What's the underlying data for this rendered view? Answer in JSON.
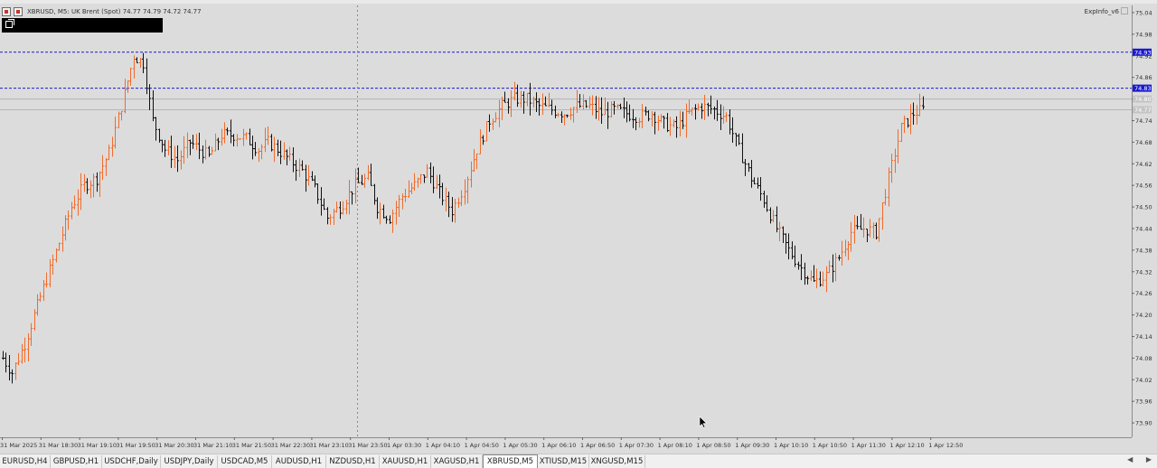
{
  "header": {
    "symbol_line": "XBRUSD, M5:  UK Brent (Spot)  74.77 74.79 74.72 74.77",
    "indicator": "ExpInfo_v6"
  },
  "colors": {
    "background": "#dcdcdc",
    "bull": "#f26b2a",
    "bear": "#111111",
    "hline": "#1a1ad0",
    "price_tag": "#1a1ad0",
    "gray_tag": "#c4c4c4"
  },
  "chart_data": {
    "type": "ohlc",
    "title": "XBRUSD, M5",
    "ylim": [
      73.86,
      75.06
    ],
    "price_ticks": [
      "75.04",
      "74.98",
      "74.92",
      "74.86",
      "74.80",
      "74.74",
      "74.68",
      "74.62",
      "74.56",
      "74.50",
      "74.44",
      "74.38",
      "74.32",
      "74.26",
      "74.20",
      "74.14",
      "74.08",
      "74.02",
      "73.96",
      "73.90"
    ],
    "price_tags": [
      {
        "label": "74.93",
        "value": 74.93,
        "style": "blue"
      },
      {
        "label": "74.83",
        "value": 74.83,
        "style": "blue"
      },
      {
        "label": "74.80",
        "value": 74.8,
        "style": "gray"
      },
      {
        "label": "74.77",
        "value": 74.77,
        "style": "gray"
      }
    ],
    "hlines": [
      74.93,
      74.83
    ],
    "gray_lines": [
      74.8,
      74.77
    ],
    "time_labels": [
      "31 Mar 2025",
      "31 Mar 18:30",
      "31 Mar 19:10",
      "31 Mar 19:50",
      "31 Mar 20:30",
      "31 Mar 21:10",
      "31 Mar 21:50",
      "31 Mar 22:30",
      "31 Mar 23:10",
      "31 Mar 23:50",
      "1 Apr 03:30",
      "1 Apr 04:10",
      "1 Apr 04:50",
      "1 Apr 05:30",
      "1 Apr 06:10",
      "1 Apr 06:50",
      "1 Apr 07:30",
      "1 Apr 08:10",
      "1 Apr 08:50",
      "1 Apr 09:30",
      "1 Apr 10:10",
      "1 Apr 10:50",
      "1 Apr 11:30",
      "1 Apr 12:10",
      "1 Apr 12:50"
    ],
    "bar_count": 240,
    "close_path": [
      [
        0,
        74.08
      ],
      [
        3,
        74.04
      ],
      [
        7,
        74.12
      ],
      [
        10,
        74.2
      ],
      [
        14,
        74.3
      ],
      [
        18,
        74.4
      ],
      [
        22,
        74.5
      ],
      [
        26,
        74.56
      ],
      [
        30,
        74.58
      ],
      [
        34,
        74.65
      ],
      [
        38,
        74.78
      ],
      [
        42,
        74.92
      ],
      [
        45,
        74.9
      ],
      [
        48,
        74.74
      ],
      [
        52,
        74.66
      ],
      [
        56,
        74.63
      ],
      [
        60,
        74.68
      ],
      [
        63,
        74.66
      ],
      [
        66,
        74.64
      ],
      [
        70,
        74.7
      ],
      [
        74,
        74.7
      ],
      [
        78,
        74.69
      ],
      [
        82,
        74.66
      ],
      [
        85,
        74.68
      ],
      [
        88,
        74.66
      ],
      [
        92,
        74.63
      ],
      [
        96,
        74.6
      ],
      [
        100,
        74.55
      ],
      [
        104,
        74.47
      ],
      [
        108,
        74.5
      ],
      [
        113,
        74.56
      ],
      [
        117,
        74.58
      ],
      [
        120,
        74.5
      ],
      [
        124,
        74.47
      ],
      [
        128,
        74.53
      ],
      [
        132,
        74.56
      ],
      [
        136,
        74.6
      ],
      [
        140,
        74.54
      ],
      [
        144,
        74.49
      ],
      [
        148,
        74.56
      ],
      [
        152,
        74.66
      ],
      [
        156,
        74.74
      ],
      [
        160,
        74.78
      ],
      [
        164,
        74.8
      ],
      [
        168,
        74.8
      ],
      [
        172,
        74.78
      ],
      [
        176,
        74.77
      ],
      [
        180,
        74.76
      ],
      [
        184,
        74.78
      ],
      [
        188,
        74.78
      ],
      [
        192,
        74.76
      ],
      [
        196,
        74.77
      ],
      [
        200,
        74.76
      ],
      [
        204,
        74.75
      ],
      [
        208,
        74.76
      ],
      [
        212,
        74.73
      ],
      [
        216,
        74.72
      ],
      [
        220,
        74.76
      ],
      [
        224,
        74.78
      ],
      [
        228,
        74.77
      ],
      [
        232,
        74.75
      ],
      [
        236,
        74.66
      ],
      [
        240,
        74.58
      ],
      [
        244,
        74.52
      ],
      [
        248,
        74.44
      ],
      [
        252,
        74.38
      ],
      [
        256,
        74.33
      ],
      [
        260,
        74.29
      ],
      [
        264,
        74.31
      ],
      [
        268,
        74.36
      ],
      [
        272,
        74.43
      ],
      [
        276,
        74.44
      ],
      [
        280,
        74.43
      ],
      [
        284,
        74.58
      ],
      [
        288,
        74.72
      ],
      [
        292,
        74.76
      ],
      [
        295,
        74.77
      ]
    ]
  },
  "tabs": [
    {
      "label": "EURUSD,H4",
      "active": false
    },
    {
      "label": "GBPUSD,H1",
      "active": false
    },
    {
      "label": "USDCHF,Daily",
      "active": false
    },
    {
      "label": "USDJPY,Daily",
      "active": false
    },
    {
      "label": "USDCAD,M5",
      "active": false
    },
    {
      "label": "AUDUSD,H1",
      "active": false
    },
    {
      "label": "NZDUSD,H1",
      "active": false
    },
    {
      "label": "XAUUSD,H1",
      "active": false
    },
    {
      "label": "XAGUSD,H1",
      "active": false
    },
    {
      "label": "XBRUSD,M5",
      "active": true
    },
    {
      "label": "XTIUSD,M15",
      "active": false
    },
    {
      "label": "XNGUSD,M15",
      "active": false
    }
  ],
  "tab_arrows": {
    "left": "◀",
    "right": "▶"
  }
}
